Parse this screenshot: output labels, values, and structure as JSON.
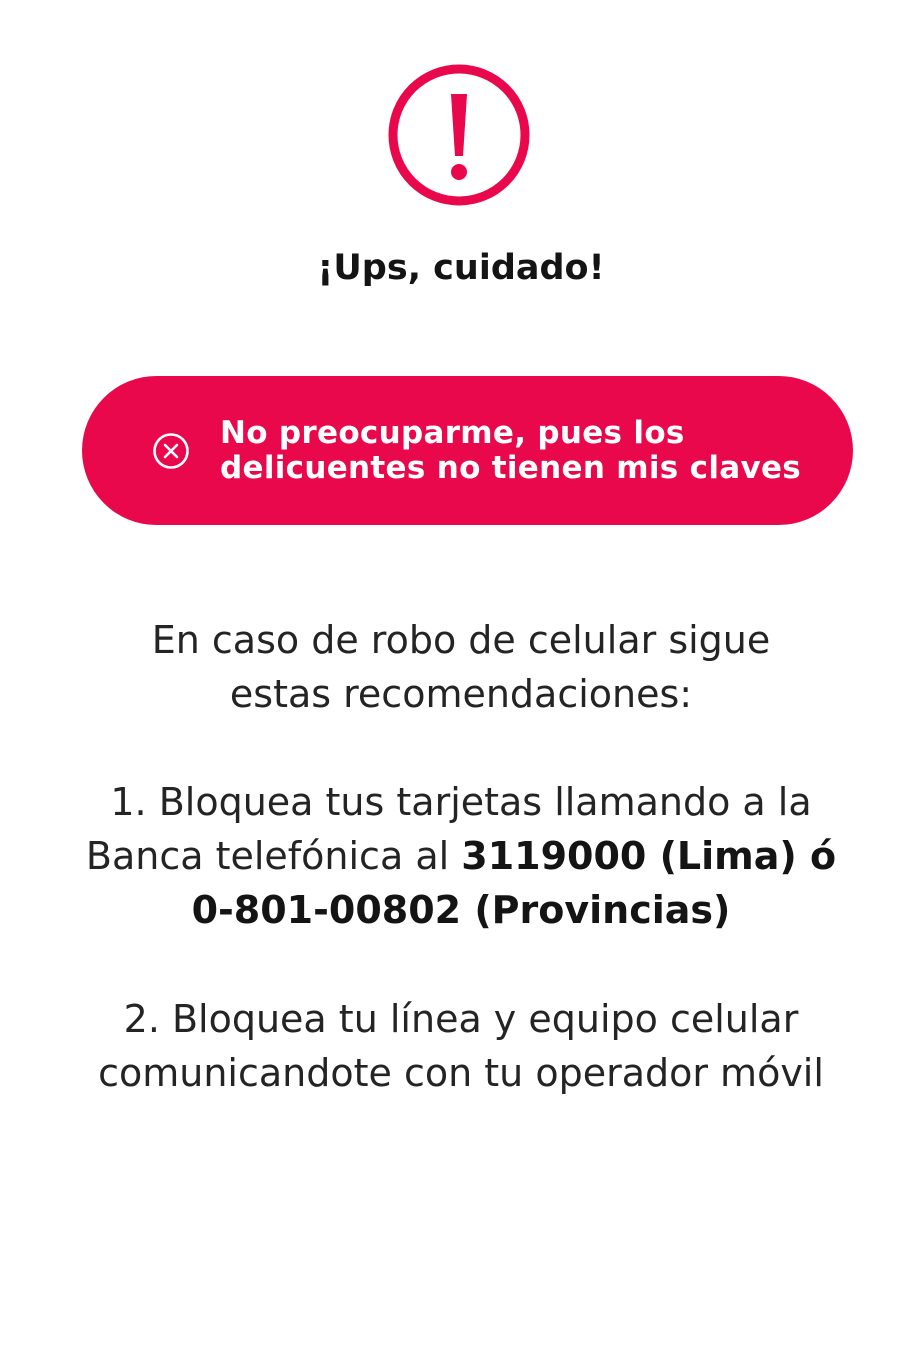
{
  "alert": {
    "icon": "exclamation-circle-icon",
    "color": "#e8084b"
  },
  "title": "¡Ups, cuidado!",
  "answer_button": {
    "icon": "close-circle-icon",
    "line1": "No preocuparme, pues los",
    "line2": "delicuentes no tienen mis claves",
    "background": "#e8084b"
  },
  "recommendations": {
    "intro_line1": "En caso de robo de celular sigue",
    "intro_line2": "estas recomendaciones:",
    "step1": {
      "line1": "1. Bloquea tus tarjetas llamando a la",
      "line2_prefix": "Banca telefónica al ",
      "line2_bold": "3119000 (Lima) ó",
      "line3_bold": "0-801-00802 (Provincias)"
    },
    "step2": {
      "line1": "2. Bloquea tu línea y equipo celular",
      "line2": "comunicandote con tu operador móvil"
    }
  }
}
